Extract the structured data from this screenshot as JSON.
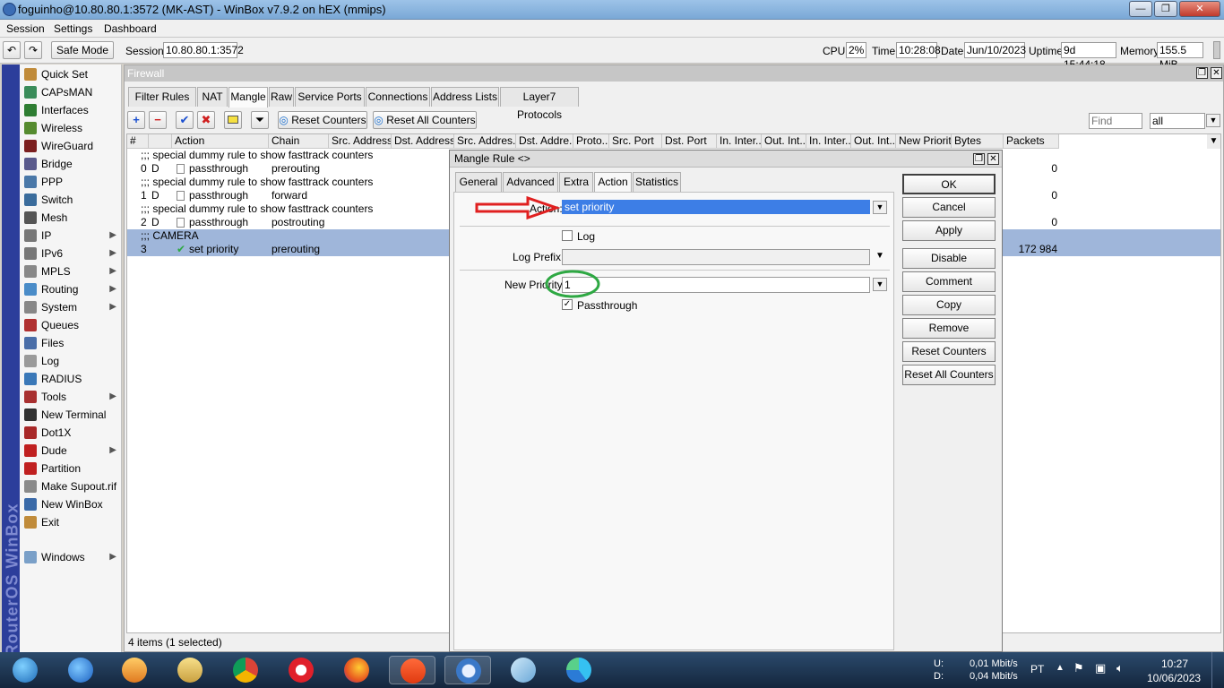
{
  "window": {
    "title": "foguinho@10.80.80.1:3572 (MK-AST) - WinBox v7.9.2 on hEX (mmips)",
    "btn_min": "—",
    "btn_max": "❐",
    "btn_close": "✕"
  },
  "menubar": [
    "Session",
    "Settings",
    "Dashboard"
  ],
  "toolbar": {
    "undo": "↶",
    "redo": "↷",
    "safe_mode": "Safe Mode",
    "session_label": "Session:",
    "session_value": "10.80.80.1:3572",
    "cpu_label": "CPU:",
    "cpu_value": "2%",
    "time_label": "Time:",
    "time_value": "10:28:08",
    "date_label": "Date:",
    "date_value": "Jun/10/2023",
    "uptime_label": "Uptime:",
    "uptime_value": "9d 15:44:18",
    "memory_label": "Memory:",
    "memory_value": "155.5 MiB"
  },
  "side_banner": "RouterOS WinBox",
  "left_menu": [
    {
      "label": "Quick Set",
      "icon": "wand-icon",
      "color": "#c08b3a",
      "arrow": false
    },
    {
      "label": "CAPsMAN",
      "icon": "capsman-icon",
      "color": "#3a8c5a",
      "arrow": false
    },
    {
      "label": "Interfaces",
      "icon": "interfaces-icon",
      "color": "#2e7d32",
      "arrow": false
    },
    {
      "label": "Wireless",
      "icon": "wireless-icon",
      "color": "#558b2f",
      "arrow": false
    },
    {
      "label": "WireGuard",
      "icon": "wireguard-icon",
      "color": "#7b1f1f",
      "arrow": false
    },
    {
      "label": "Bridge",
      "icon": "bridge-icon",
      "color": "#5a5a8c",
      "arrow": false
    },
    {
      "label": "PPP",
      "icon": "ppp-icon",
      "color": "#4a78a8",
      "arrow": false
    },
    {
      "label": "Switch",
      "icon": "switch-icon",
      "color": "#3a6c9c",
      "arrow": false
    },
    {
      "label": "Mesh",
      "icon": "mesh-icon",
      "color": "#555555",
      "arrow": false
    },
    {
      "label": "IP",
      "icon": "ip-icon",
      "color": "#777777",
      "arrow": true
    },
    {
      "label": "IPv6",
      "icon": "ipv6-icon",
      "color": "#777777",
      "arrow": true
    },
    {
      "label": "MPLS",
      "icon": "mpls-icon",
      "color": "#888888",
      "arrow": true
    },
    {
      "label": "Routing",
      "icon": "routing-icon",
      "color": "#4a8cc8",
      "arrow": true
    },
    {
      "label": "System",
      "icon": "system-icon",
      "color": "#888888",
      "arrow": true
    },
    {
      "label": "Queues",
      "icon": "queues-icon",
      "color": "#b03030",
      "arrow": false
    },
    {
      "label": "Files",
      "icon": "files-icon",
      "color": "#4a6ea8",
      "arrow": false
    },
    {
      "label": "Log",
      "icon": "log-icon",
      "color": "#9a9a9a",
      "arrow": false
    },
    {
      "label": "RADIUS",
      "icon": "radius-icon",
      "color": "#3a78b8",
      "arrow": false
    },
    {
      "label": "Tools",
      "icon": "tools-icon",
      "color": "#a83030",
      "arrow": true
    },
    {
      "label": "New Terminal",
      "icon": "terminal-icon",
      "color": "#303030",
      "arrow": false
    },
    {
      "label": "Dot1X",
      "icon": "dot1x-icon",
      "color": "#a82828",
      "arrow": false
    },
    {
      "label": "Dude",
      "icon": "dude-icon",
      "color": "#c02020",
      "arrow": true
    },
    {
      "label": "Partition",
      "icon": "partition-icon",
      "color": "#c02020",
      "arrow": false
    },
    {
      "label": "Make Supout.rif",
      "icon": "supout-icon",
      "color": "#8a8a8a",
      "arrow": false
    },
    {
      "label": "New WinBox",
      "icon": "winbox-icon",
      "color": "#3a6aa8",
      "arrow": false
    },
    {
      "label": "Exit",
      "icon": "exit-icon",
      "color": "#c08b3a",
      "arrow": false
    },
    {
      "label": "Windows",
      "icon": "windows-icon",
      "color": "#7aa0c8",
      "arrow": true
    }
  ],
  "firewall": {
    "title": "Firewall",
    "tabs": [
      "Filter Rules",
      "NAT",
      "Mangle",
      "Raw",
      "Service Ports",
      "Connections",
      "Address Lists",
      "Layer7 Protocols"
    ],
    "active_tab": "Mangle",
    "reset_counters": "Reset Counters",
    "reset_all_counters": "Reset All Counters",
    "find_placeholder": "Find",
    "filter_value": "all",
    "columns": [
      "#",
      "",
      "Action",
      "Chain",
      "Src. Address",
      "Dst. Address",
      "Src. Addres...",
      "Dst. Addre...",
      "Proto...",
      "Src. Port",
      "Dst. Port",
      "In. Inter...",
      "Out. Int...",
      "In. Inter...",
      "Out. Int...",
      "New Priority",
      "Bytes",
      "Packets"
    ],
    "rows": [
      {
        "type": "comment",
        "text": ";;; special dummy rule to show fasttrack counters"
      },
      {
        "type": "rule",
        "num": "0",
        "flag": "D",
        "action": "passthrough",
        "chain": "prerouting",
        "packets": "0"
      },
      {
        "type": "comment",
        "text": ";;; special dummy rule to show fasttrack counters"
      },
      {
        "type": "rule",
        "num": "1",
        "flag": "D",
        "action": "passthrough",
        "chain": "forward",
        "packets": "0"
      },
      {
        "type": "comment",
        "text": ";;; special dummy rule to show fasttrack counters"
      },
      {
        "type": "rule",
        "num": "2",
        "flag": "D",
        "action": "passthrough",
        "chain": "postrouting",
        "packets": "0"
      },
      {
        "type": "comment-selected",
        "text": ";;; CAMERA"
      },
      {
        "type": "rule-selected",
        "num": "3",
        "flag": "",
        "action": "set priority",
        "chain": "prerouting",
        "packets": "172 984"
      }
    ],
    "status": "4 items (1 selected)"
  },
  "dialog": {
    "title": "Mangle Rule <>",
    "tabs": [
      "General",
      "Advanced",
      "Extra",
      "Action",
      "Statistics"
    ],
    "active_tab": "Action",
    "action_label": "Action:",
    "action_value": "set priority",
    "log_label": "Log",
    "log_checked": false,
    "log_prefix_label": "Log Prefix:",
    "log_prefix_value": "",
    "new_priority_label": "New Priority:",
    "new_priority_value": "1",
    "passthrough_label": "Passthrough",
    "passthrough_checked": true,
    "buttons": [
      "OK",
      "Cancel",
      "Apply",
      "Disable",
      "Comment",
      "Copy",
      "Remove",
      "Reset Counters",
      "Reset All Counters"
    ]
  },
  "taskbar": {
    "apps": [
      "start-orb",
      "ie-icon",
      "media-player-icon",
      "explorer-icon",
      "chrome-icon",
      "opera-icon",
      "firefox-icon",
      "brave-icon",
      "winbox-taskbar-icon",
      "notes-icon",
      "edge-icon"
    ],
    "upload_label": "U:",
    "download_label": "D:",
    "upload_rate": "0,01 Mbit/s",
    "download_rate": "0,04 Mbit/s",
    "language": "PT",
    "time": "10:27",
    "date": "10/06/2023"
  },
  "colors": {
    "accent_red": "#e02020",
    "accent_green": "#2ea843",
    "selection": "#9fb6da",
    "action_highlight": "#3d7ee6"
  }
}
